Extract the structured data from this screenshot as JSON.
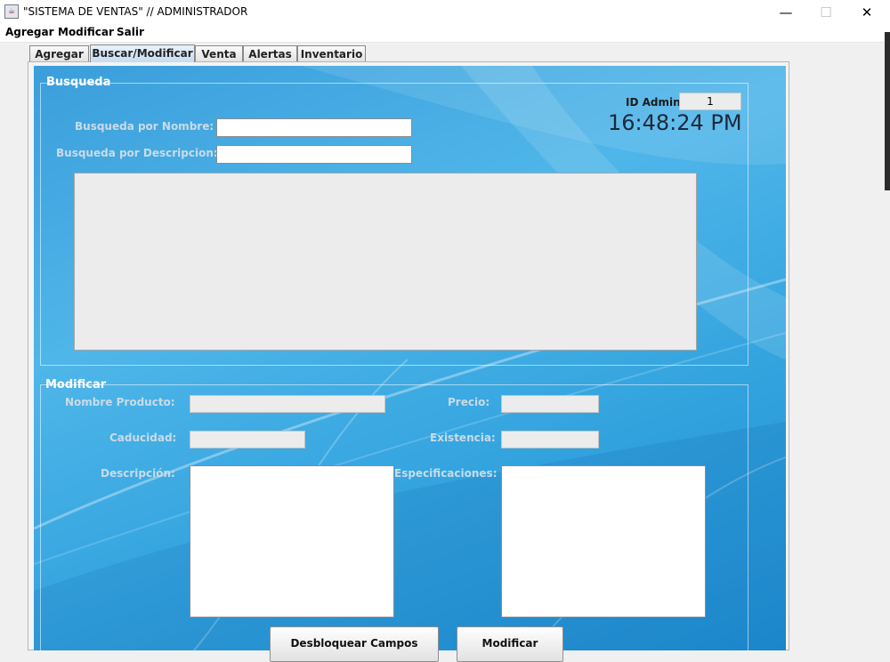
{
  "window": {
    "title": "\"SISTEMA DE VENTAS\" // ADMINISTRADOR",
    "icon": "java-cup-icon"
  },
  "controls": {
    "minimize": "—",
    "maximize": "☐",
    "close": "✕"
  },
  "menu": [
    "Agregar",
    "Modificar",
    "Salir"
  ],
  "tabs": [
    "Agregar",
    "Buscar/Modificar",
    "Venta",
    "Alertas",
    "Inventario"
  ],
  "active_tab": "Buscar/Modificar",
  "busqueda": {
    "title": "Busqueda",
    "id_admin_label": "ID Admin:",
    "id_admin_value": "1",
    "clock": "16:48:24 PM",
    "nombre_label": "Busqueda por Nombre:",
    "nombre_value": "",
    "descripcion_label": "Busqueda por Descripcion:",
    "descripcion_value": ""
  },
  "modificar": {
    "title": "Modificar",
    "nombre_label": "Nombre Producto:",
    "precio_label": "Precio:",
    "caducidad_label": "Caducidad:",
    "existencia_label": "Existencia:",
    "descripcion_label": "Descripción:",
    "especificaciones_label": "Especificaciones:",
    "desbloquear_button": "Desbloquear Campos",
    "modificar_button": "Modificar"
  },
  "colors": {
    "panel_blue": "#3aa6e0",
    "label_gray": "#c9dbe6",
    "active_tab": "#c6dcf2"
  }
}
